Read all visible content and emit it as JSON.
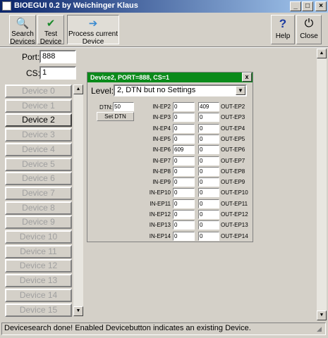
{
  "window": {
    "title": "BIOEGUI 0.2 by Weichinger Klaus",
    "minimize": "_",
    "maximize": "□",
    "close": "×"
  },
  "toolbar": {
    "search": {
      "line1": "Search",
      "line2": "Devices",
      "icon": "magnifier-icon",
      "glyph": "🔍"
    },
    "test": {
      "line1": "Test",
      "line2": "Device",
      "icon": "check-icon",
      "glyph": "✔"
    },
    "process": {
      "line1": "Process current",
      "line2": "Device",
      "icon": "arrow-icon",
      "glyph": "➔"
    },
    "help": {
      "label": "Help",
      "icon": "question-icon",
      "glyph": "?"
    },
    "close": {
      "label": "Close",
      "icon": "power-icon",
      "glyph": "⏻"
    }
  },
  "connection": {
    "port_label": "Port:",
    "port_value": "888",
    "cs_label": "CS:",
    "cs_value": "1"
  },
  "devices": [
    {
      "label": "Device 0",
      "enabled": false
    },
    {
      "label": "Device 1",
      "enabled": false
    },
    {
      "label": "Device 2",
      "enabled": true
    },
    {
      "label": "Device 3",
      "enabled": false
    },
    {
      "label": "Device 4",
      "enabled": false
    },
    {
      "label": "Device 5",
      "enabled": false
    },
    {
      "label": "Device 6",
      "enabled": false
    },
    {
      "label": "Device 7",
      "enabled": false
    },
    {
      "label": "Device 8",
      "enabled": false
    },
    {
      "label": "Device 9",
      "enabled": false
    },
    {
      "label": "Device 10",
      "enabled": false
    },
    {
      "label": "Device 11",
      "enabled": false
    },
    {
      "label": "Device 12",
      "enabled": false
    },
    {
      "label": "Device 13",
      "enabled": false
    },
    {
      "label": "Device 14",
      "enabled": false
    },
    {
      "label": "Device 15",
      "enabled": false
    }
  ],
  "device_window": {
    "title": "Device2, PORT=888, CS=1",
    "close": "x",
    "level_label": "Level:",
    "level_value": "2, DTN but no Settings",
    "dtn_label": "DTN:",
    "dtn_value": "50",
    "set_dtn_label": "Set DTN",
    "endpoints": [
      {
        "in_label": "IN-EP2",
        "in": "0",
        "out": "409",
        "out_label": "OUT-EP2"
      },
      {
        "in_label": "IN-EP3",
        "in": "0",
        "out": "0",
        "out_label": "OUT-EP3"
      },
      {
        "in_label": "IN-EP4",
        "in": "0",
        "out": "0",
        "out_label": "OUT-EP4"
      },
      {
        "in_label": "IN-EP5",
        "in": "0",
        "out": "0",
        "out_label": "OUT-EP5"
      },
      {
        "in_label": "IN-EP6",
        "in": "609",
        "out": "0",
        "out_label": "OUT-EP6"
      },
      {
        "in_label": "IN-EP7",
        "in": "0",
        "out": "0",
        "out_label": "OUT-EP7"
      },
      {
        "in_label": "IN-EP8",
        "in": "0",
        "out": "0",
        "out_label": "OUT-EP8"
      },
      {
        "in_label": "IN-EP9",
        "in": "0",
        "out": "0",
        "out_label": "OUT-EP9"
      },
      {
        "in_label": "IN-EP10",
        "in": "0",
        "out": "0",
        "out_label": "OUT-EP10"
      },
      {
        "in_label": "IN-EP11",
        "in": "0",
        "out": "0",
        "out_label": "OUT-EP11"
      },
      {
        "in_label": "IN-EP12",
        "in": "0",
        "out": "0",
        "out_label": "OUT-EP12"
      },
      {
        "in_label": "IN-EP13",
        "in": "0",
        "out": "0",
        "out_label": "OUT-EP13"
      },
      {
        "in_label": "IN-EP14",
        "in": "0",
        "out": "0",
        "out_label": "OUT-EP14"
      }
    ]
  },
  "status": "Devicesearch done! Enabled Devicebutton indicates an existing Device.",
  "colors": {
    "titlebar_start": "#0a246a",
    "titlebar_end": "#a6caf0",
    "device_titlebar": "#0a8a1a",
    "face": "#d4d0c8"
  }
}
